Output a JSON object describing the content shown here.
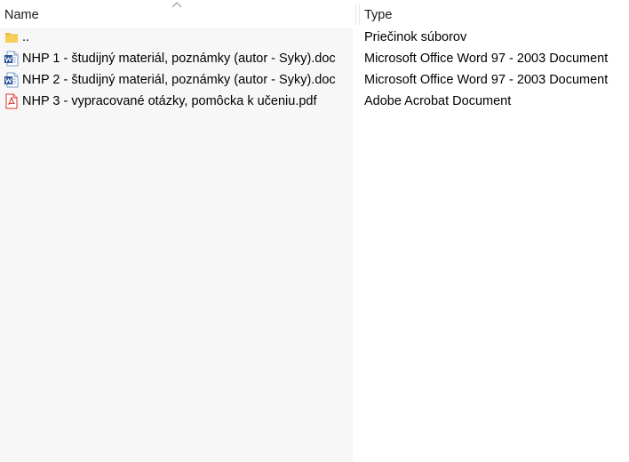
{
  "header": {
    "name_label": "Name",
    "type_label": "Type",
    "sort_indicator": "chevron-up-icon"
  },
  "rows": [
    {
      "name": "..",
      "type": "Priečinok súborov",
      "icon": "folder-icon"
    },
    {
      "name": "NHP 1 - študijný materiál, poznámky (autor - Syky).doc",
      "type": "Microsoft Office Word 97 - 2003 Document",
      "icon": "word-document-icon"
    },
    {
      "name": "NHP 2 - študijný materiál, poznámky (autor - Syky).doc",
      "type": "Microsoft Office Word 97 - 2003 Document",
      "icon": "word-document-icon"
    },
    {
      "name": "NHP 3 - vypracované otázky, pomôcka k učeniu.pdf",
      "type": "Adobe Acrobat Document",
      "icon": "pdf-document-icon"
    }
  ],
  "colors": {
    "name_column_background": "#f7f7f7",
    "folder": "#f3c74e",
    "word": "#2b5797",
    "pdf": "#d9302c"
  }
}
